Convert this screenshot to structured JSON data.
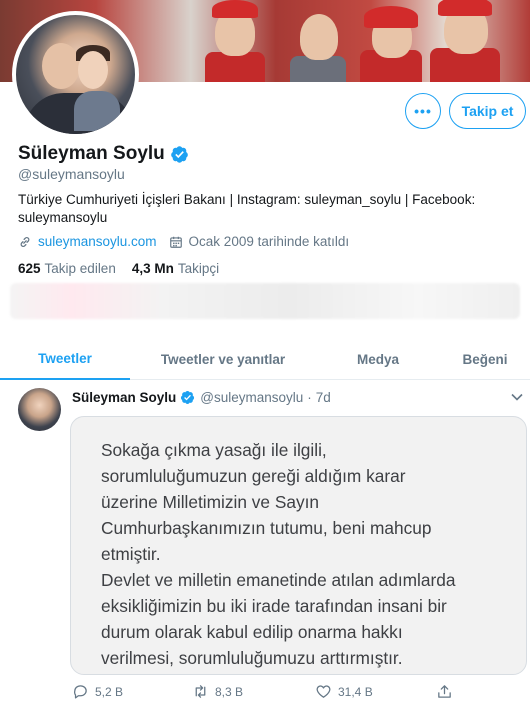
{
  "profile": {
    "follow_label": "Takip et",
    "more_label": "•••",
    "display_name": "Süleyman Soylu",
    "handle": "@suleymansoylu",
    "bio_line1": "Türkiye Cumhuriyeti İçişleri Bakanı | Instagram: suleyman_soylu | Facebook:",
    "bio_line2": "suleymansoylu",
    "website": "suleymansoylu.com",
    "joined": "Ocak 2009 tarihinde katıldı",
    "following_count": "625",
    "following_label": "Takip edilen",
    "followers_count": "4,3 Mn",
    "followers_label": "Takipçi"
  },
  "tabs": [
    {
      "label": "Tweetler",
      "active": true
    },
    {
      "label": "Tweetler ve yanıtlar",
      "active": false
    },
    {
      "label": "Medya",
      "active": false
    },
    {
      "label": "Beğeni",
      "active": false
    }
  ],
  "tweet": {
    "name": "Süleyman Soylu",
    "handle": "@suleymansoylu",
    "separator": "·",
    "time": "7d",
    "image_text": [
      "Sokağa çıkma yasağı ile ilgili,",
      "sorumluluğumuzun gereği aldığım karar",
      "üzerine Milletimizin ve Sayın",
      "Cumhurbaşkanımızın tutumu, beni mahcup",
      "etmiştir.",
      "Devlet ve milletin emanetinde atılan adımlarda",
      "eksikliğimizin bu iki irade tarafından insani bir",
      "durum olarak kabul edilip onarma hakkı",
      "verilmesi, sorumluluğumuzu arttırmıştır."
    ],
    "replies": "5,2 B",
    "retweets": "8,3 B",
    "likes": "31,4 B"
  },
  "colors": {
    "accent": "#1da1f2",
    "link": "#1b95e0",
    "muted": "#657786"
  },
  "icons": [
    "verified-badge-icon",
    "link-icon",
    "calendar-icon",
    "chevron-down-icon",
    "reply-icon",
    "retweet-icon",
    "like-icon",
    "share-icon"
  ]
}
